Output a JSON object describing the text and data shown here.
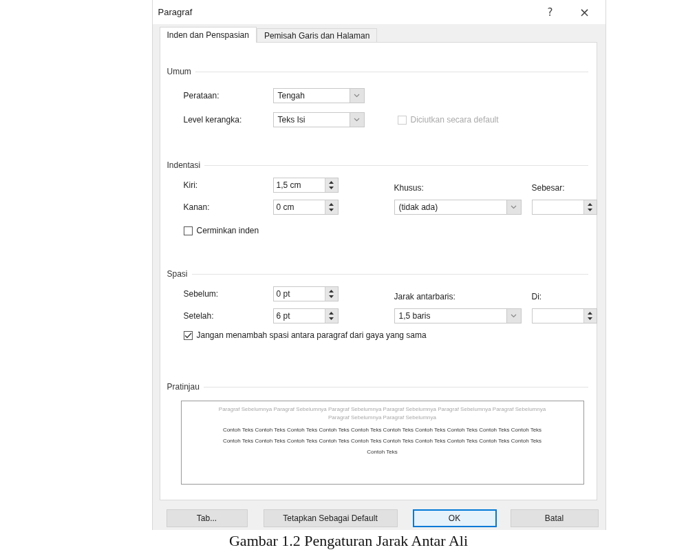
{
  "window": {
    "title": "Paragraf",
    "help": "?",
    "close": "×"
  },
  "tabs": [
    {
      "label": "Inden dan Penspasian",
      "selected": true
    },
    {
      "label": "Pemisah Garis dan Halaman",
      "selected": false
    }
  ],
  "general": {
    "title": "Umum",
    "alignment": {
      "label": "Perataan:",
      "value": "Tengah"
    },
    "outline_level": {
      "label": "Level kerangka:",
      "value": "Teks Isi"
    },
    "collapsed": {
      "label": "Diciutkan secara default",
      "checked": false,
      "disabled": true
    }
  },
  "indentation": {
    "title": "Indentasi",
    "left": {
      "label": "Kiri:",
      "value": "1,5 cm"
    },
    "right": {
      "label": "Kanan:",
      "value": "0 cm"
    },
    "special": {
      "label": "Khusus:",
      "value": "(tidak ada)"
    },
    "by": {
      "label": "Sebesar:"
    },
    "mirror": {
      "label": "Cerminkan inden",
      "checked": false,
      "disabled": false
    }
  },
  "spacing": {
    "title": "Spasi",
    "before": {
      "label": "Sebelum:",
      "value": "0 pt"
    },
    "after": {
      "label": "Setelah:",
      "value": "6 pt"
    },
    "line_spacing": {
      "label": "Jarak antarbaris:",
      "value": "1,5 baris"
    },
    "at": {
      "label": "Di:"
    },
    "dont_add": {
      "label": "Jangan menambah spasi antara paragraf dari gaya yang sama",
      "checked": true,
      "disabled": false
    }
  },
  "preview": {
    "title": "Pratinjau",
    "previous_text": "Paragraf Sebelumnya Paragraf Sebelumnya Paragraf Sebelumnya Paragraf Sebelumnya Paragraf Sebelumnya Paragraf Sebelumnya Paragraf Sebelumnya Paragraf Sebelumnya",
    "sample_text": "Contoh Teks Contoh Teks Contoh Teks Contoh Teks Contoh Teks Contoh Teks Contoh Teks Contoh Teks Contoh Teks Contoh Teks Contoh Teks Contoh Teks Contoh Teks Contoh Teks Contoh Teks Contoh Teks Contoh Teks Contoh Teks Contoh Teks Contoh Teks Contoh Teks"
  },
  "buttons": [
    {
      "label": "Tab...",
      "default": false
    },
    {
      "label": "Tetapkan Sebagai Default",
      "default": false
    },
    {
      "label": "OK",
      "default": true
    },
    {
      "label": "Batal",
      "default": false
    }
  ],
  "caption": "Gambar 1.2 Pengaturan Jarak Antar Ali"
}
